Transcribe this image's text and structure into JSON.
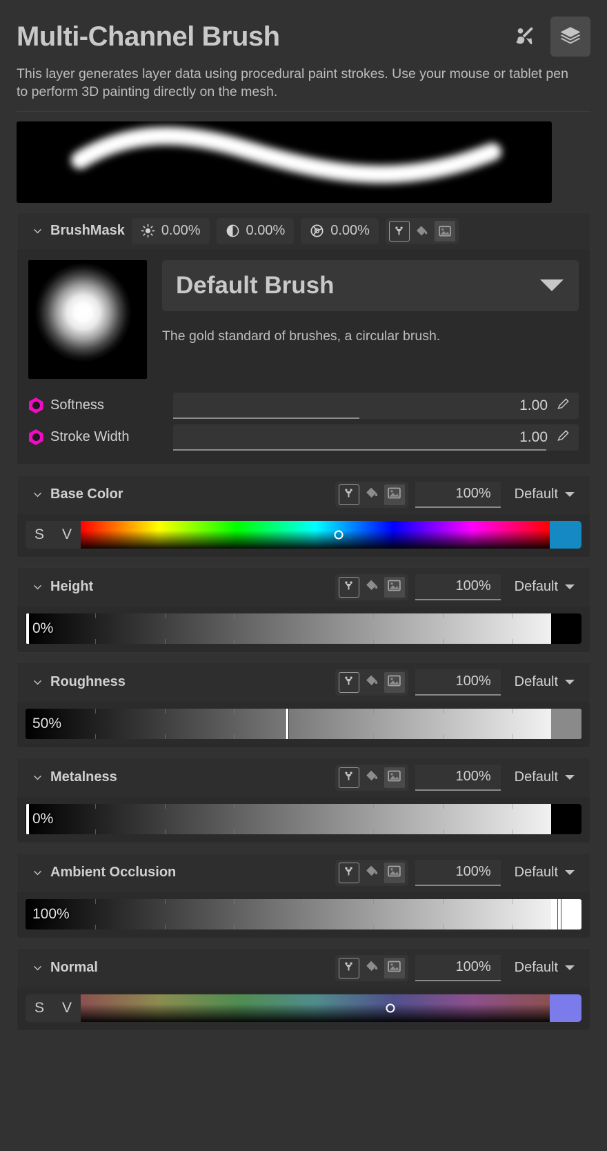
{
  "header": {
    "title": "Multi-Channel Brush",
    "description": "This layer generates layer data using procedural paint strokes. Use your mouse or tablet pen to perform 3D painting directly on the mesh.",
    "icons": [
      {
        "name": "paint-brush-pen-icon",
        "label": "Paint Tools",
        "active": false
      },
      {
        "name": "layers-stack-icon",
        "label": "Layers",
        "active": true
      }
    ]
  },
  "stroke_preview": {
    "name": "brush-stroke-preview",
    "background": "#000000",
    "stroke_color": "#ffffff"
  },
  "brush_mask": {
    "section_name": "BrushMask",
    "stats": [
      {
        "icon": "brightness-icon",
        "value": "0.00%"
      },
      {
        "icon": "contrast-icon",
        "value": "0.00%"
      },
      {
        "icon": "saturation-aperture-icon",
        "value": "0.00%"
      }
    ],
    "tool_icons": [
      {
        "name": "node-graph-icon",
        "state": "boxed"
      },
      {
        "name": "paint-bucket-icon",
        "state": "dim"
      },
      {
        "name": "image-texture-icon",
        "state": "dim"
      }
    ],
    "brush": {
      "name": "Default Brush",
      "description": "The gold standard of brushes, a circular brush.",
      "thumbnail": "radial-soft-circle"
    },
    "params": [
      {
        "label": "Softness",
        "value": "1.00",
        "fill_percent": 46,
        "socket_color": "#f20ac4"
      },
      {
        "label": "Stroke Width",
        "value": "1.00",
        "fill_percent": 92,
        "socket_color": "#f20ac4"
      }
    ]
  },
  "channels": [
    {
      "name": "Base Color",
      "opacity": "100%",
      "blend_mode": "Default",
      "tool_icons": [
        "node-graph-icon",
        "paint-bucket-icon",
        "image-texture-icon"
      ],
      "editor": "hsv",
      "sv_labels": [
        "S",
        "V"
      ],
      "hue_position_percent": 55,
      "swatch_color": "#1489c4"
    },
    {
      "name": "Height",
      "opacity": "100%",
      "blend_mode": "Default",
      "tool_icons": [
        "node-graph-icon",
        "paint-bucket-icon",
        "image-texture-icon"
      ],
      "editor": "grayscale",
      "value_label": "0%",
      "handle_percent": 0.4,
      "tail_color": "#000000"
    },
    {
      "name": "Roughness",
      "opacity": "100%",
      "blend_mode": "Default",
      "tool_icons": [
        "node-graph-icon",
        "paint-bucket-icon",
        "image-texture-icon"
      ],
      "editor": "grayscale",
      "value_label": "50%",
      "handle_percent": 47,
      "tail_color": "#8a8a8a"
    },
    {
      "name": "Metalness",
      "opacity": "100%",
      "blend_mode": "Default",
      "tool_icons": [
        "node-graph-icon",
        "paint-bucket-icon",
        "image-texture-icon"
      ],
      "editor": "grayscale",
      "value_label": "0%",
      "handle_percent": 0.4,
      "tail_color": "#000000"
    },
    {
      "name": "Ambient Occlusion",
      "opacity": "100%",
      "blend_mode": "Default",
      "tool_icons": [
        "node-graph-icon",
        "paint-bucket-icon",
        "image-texture-icon"
      ],
      "editor": "grayscale",
      "value_label": "100%",
      "handle_percent": 96,
      "tail_color": "#ffffff"
    },
    {
      "name": "Normal",
      "opacity": "100%",
      "blend_mode": "Default",
      "tool_icons": [
        "node-graph-icon",
        "paint-bucket-icon",
        "image-texture-icon"
      ],
      "editor": "hsv",
      "sv_labels": [
        "S",
        "V"
      ],
      "hue_position_percent": 66,
      "swatch_color": "#7b7bec",
      "desaturated": true
    }
  ],
  "theme": {
    "background": "#323232",
    "card_background": "#2b2b2b",
    "header_background": "#2e2e2e",
    "text": "#c8c8c8",
    "accent_socket": "#f20ac4"
  }
}
